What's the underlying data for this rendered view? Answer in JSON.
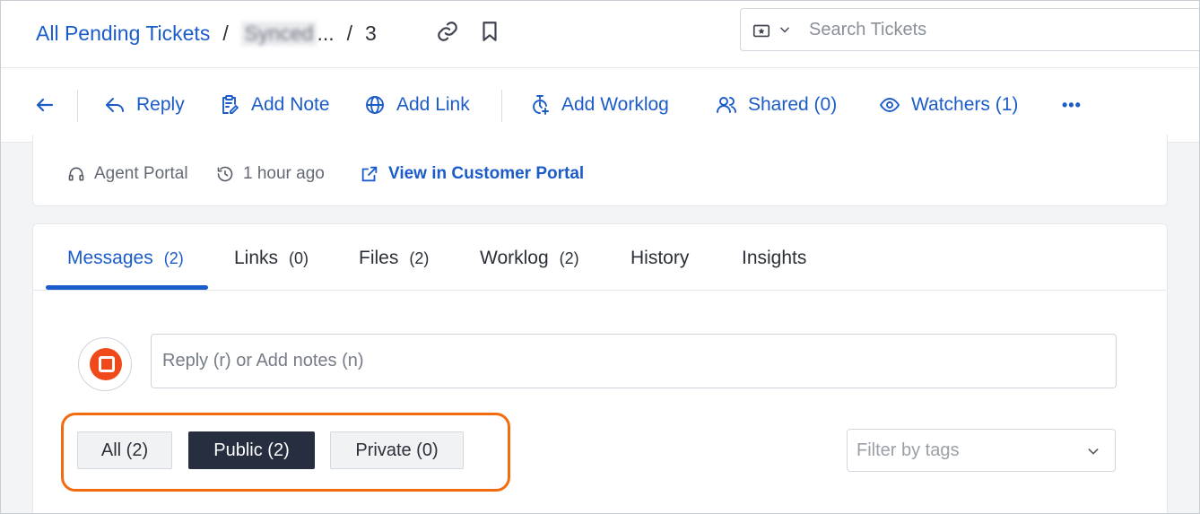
{
  "header": {
    "breadcrumb_root": "All Pending Tickets",
    "separator": "/",
    "ticket_name_blurred": "Synced",
    "ellipsis": "...",
    "ticket_number": "3",
    "search_placeholder": "Search Tickets"
  },
  "toolbar": {
    "reply": "Reply",
    "add_note": "Add Note",
    "add_link": "Add Link",
    "add_worklog": "Add Worklog",
    "shared": "Shared (0)",
    "watchers": "Watchers (1)",
    "more": "•••"
  },
  "info": {
    "source": "Agent Portal",
    "time_ago": "1 hour ago",
    "customer_portal_link": "View in Customer Portal"
  },
  "tabs": [
    {
      "label": "Messages",
      "count": "(2)"
    },
    {
      "label": "Links",
      "count": "(0)"
    },
    {
      "label": "Files",
      "count": "(2)"
    },
    {
      "label": "Worklog",
      "count": "(2)"
    },
    {
      "label": "History",
      "count": ""
    },
    {
      "label": "Insights",
      "count": ""
    }
  ],
  "composer": {
    "placeholder": "Reply (r) or Add notes (n)"
  },
  "filters": {
    "all": "All (2)",
    "public": "Public (2)",
    "private": "Private (0)",
    "tags_placeholder": "Filter by tags"
  },
  "colors": {
    "accent": "#1c5cc9",
    "highlight": "#f26b0f",
    "active_filter_bg": "#262e3f",
    "avatar_brand": "#f04a1a"
  }
}
